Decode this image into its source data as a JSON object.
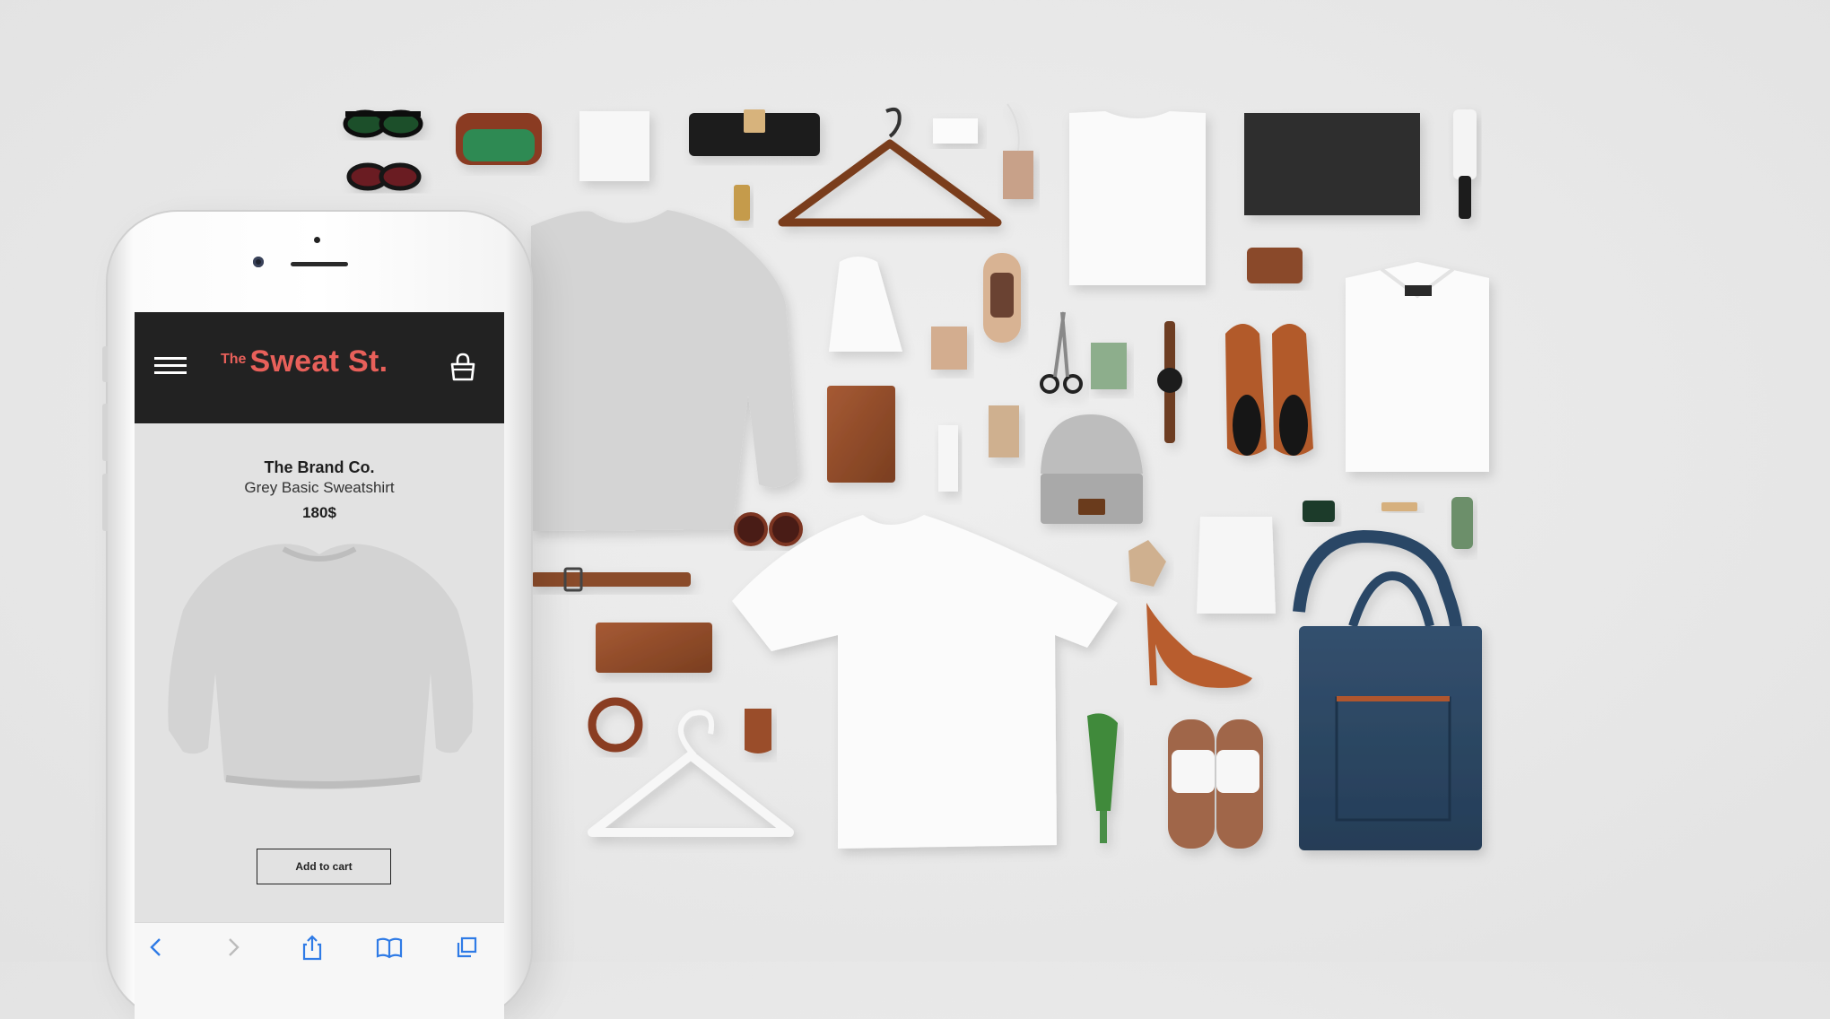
{
  "app": {
    "logo_prefix": "The",
    "logo_name": "Sweat St."
  },
  "product": {
    "brand": "The Brand Co.",
    "name": "Grey Basic Sweatshirt",
    "price": "180$"
  },
  "actions": {
    "add_to_cart": "Add to cart"
  },
  "colors": {
    "header_bg": "#222222",
    "logo": "#e8605a",
    "background": "#e8e8e8"
  },
  "icons": {
    "menu": "hamburger-menu-icon",
    "cart": "shopping-bag-icon",
    "back": "chevron-left-icon",
    "forward": "chevron-right-icon",
    "share": "share-icon",
    "bookmarks": "open-book-icon",
    "tabs": "tabs-icon"
  }
}
